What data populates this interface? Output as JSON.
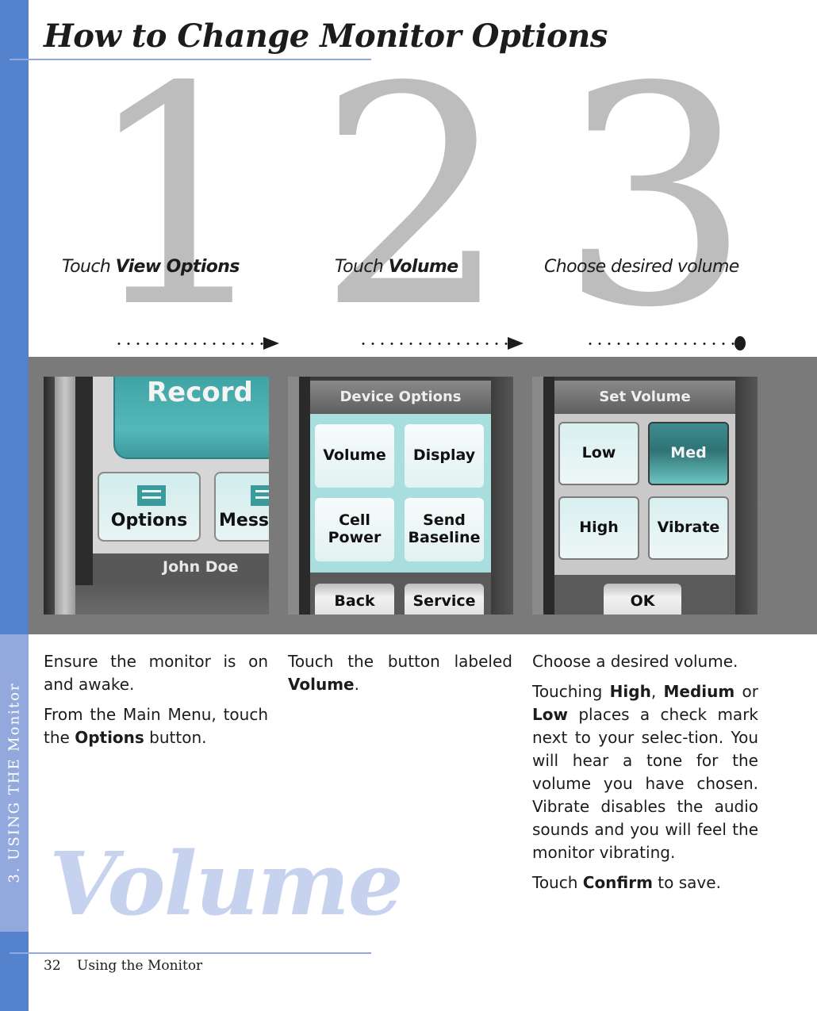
{
  "header": {
    "title": "How to Change Monitor Options"
  },
  "sidebar": {
    "section_label": "3. USING THE Monitor"
  },
  "steps": [
    {
      "number": "1",
      "caption_prefix": "Touch ",
      "caption_bold": "View Options",
      "connector": "arrow",
      "screen": {
        "main_button": "Record",
        "buttons": [
          "Options",
          "Mess"
        ],
        "user_name": "John Doe"
      },
      "description": {
        "p1": "Ensure the monitor is on and awake.",
        "p2_prefix": "From the Main Menu, touch the ",
        "p2_bold": "Options",
        "p2_suffix": " button."
      }
    },
    {
      "number": "2",
      "caption_prefix": "Touch ",
      "caption_bold": "Volume",
      "connector": "arrow",
      "screen": {
        "title": "Device Options",
        "grid": [
          "Volume",
          "Display",
          "Cell Power",
          "Send Baseline"
        ],
        "footer": [
          "Back",
          "Service"
        ]
      },
      "description": {
        "p1_prefix": "Touch the button labeled ",
        "p1_bold": "Volume",
        "p1_suffix": "."
      }
    },
    {
      "number": "3",
      "caption_prefix": "Choose desired volume",
      "caption_bold": "",
      "connector": "end-dot",
      "screen": {
        "title": "Set Volume",
        "grid": [
          "Low",
          "Med",
          "High",
          "Vibrate"
        ],
        "selected": "Med",
        "footer": [
          "OK"
        ]
      },
      "description": {
        "p1": "Choose a desired volume.",
        "p2_a": "Touching ",
        "p2_b1": "High",
        "p2_c": ", ",
        "p2_b2": "Medium",
        "p2_d": " or ",
        "p2_b3": "Low",
        "p2_e": " places a check mark next to your selec-tion. You will hear a tone for the volume you have chosen. Vibrate disables the audio sounds and you will feel the monitor vibrating.",
        "p3_prefix": "Touch ",
        "p3_bold": "Confirm",
        "p3_suffix": " to save."
      }
    }
  ],
  "watermark": "Volume",
  "footer": {
    "page_number": "32",
    "section": "Using the Monitor"
  },
  "colors": {
    "sidebar": "#5582cc",
    "sidebar_tab": "#93a9dd",
    "band": "#7b7a7a",
    "big_numbers": "#bdbdbd",
    "watermark": "#c7d2ef",
    "selected_button": "#2f7376"
  }
}
